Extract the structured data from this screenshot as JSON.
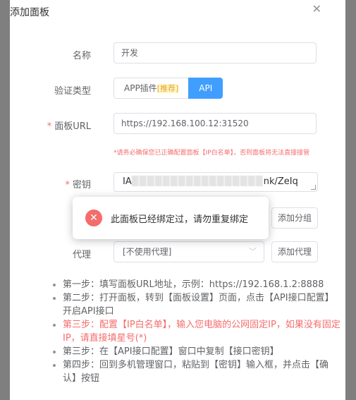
{
  "dialog": {
    "title": "添加面板",
    "close_icon": "✕"
  },
  "form": {
    "name": {
      "label": "名称",
      "value": "开发"
    },
    "verify_type": {
      "label": "验证类型",
      "options": [
        "APP插件",
        "API"
      ],
      "recommend_tag": "[推荐]",
      "selected": "API"
    },
    "url": {
      "required_mark": "*",
      "label": "面板URL",
      "value": "https://192.168.100.12:31520"
    },
    "warning": "*请务必确保您已正确配置面板【IP白名单】，否则面板将无法直接接管",
    "key": {
      "required_mark": "*",
      "label": "密钥",
      "value_start": "IA",
      "value_end": "nk/ZeIq"
    },
    "group": {
      "add_button": "添加分组"
    },
    "proxy": {
      "label": "代理",
      "selected": "[不使用代理]",
      "add_button": "添加代理"
    }
  },
  "steps": [
    "第一步：填写面板URL地址，示例：https://192.168.1.2:8888",
    "第二步：打开面板，转到【面板设置】页面，点击【API接口配置】开启API接口",
    "第三步：配置【IP白名单】，输入您电脑的公网固定IP，如果没有固定IP，请直接填星号(*)",
    "第三步：在【API接口配置】窗口中复制【接口密钥】",
    "第四步：回到多机管理窗口，粘贴到【密钥】输入框，并点击【确认】按钮"
  ],
  "toast": {
    "message": "此面板已经绑定过，请勿重复绑定",
    "icon": "✕"
  },
  "colors": {
    "primary": "#409eff",
    "danger": "#f56c6c",
    "recommend": "#e6a23c"
  }
}
